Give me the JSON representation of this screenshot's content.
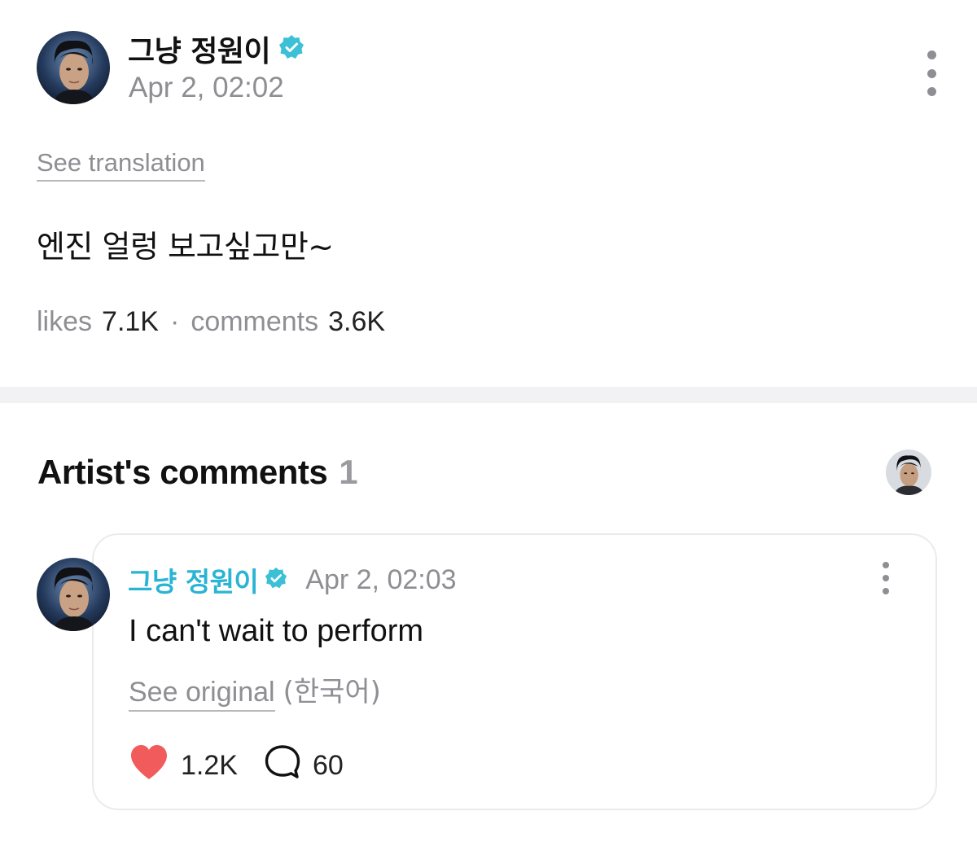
{
  "post": {
    "author": "그냥 정원이",
    "verified_icon": "verified-badge-icon",
    "date": "Apr 2, 02:02",
    "see_translation": "See translation",
    "body": "엔진 얼렁 보고싶고만~",
    "likes_label": "likes",
    "likes_count": "7.1K",
    "separator": "·",
    "comments_label": "comments",
    "comments_count": "3.6K"
  },
  "artist_comments": {
    "title": "Artist's comments",
    "count": "1",
    "comment": {
      "author": "그냥 정원이",
      "date": "Apr 2, 02:03",
      "text": "I can't wait to perform",
      "see_original": "See original",
      "language": "(한국어)",
      "like_count": "1.2K",
      "reply_count": "60"
    }
  },
  "colors": {
    "accent": "#2ab4d3",
    "badge": "#3cc0d6",
    "heart": "#f15b5b",
    "muted": "#8e8e93",
    "divider": "#f2f2f4"
  }
}
